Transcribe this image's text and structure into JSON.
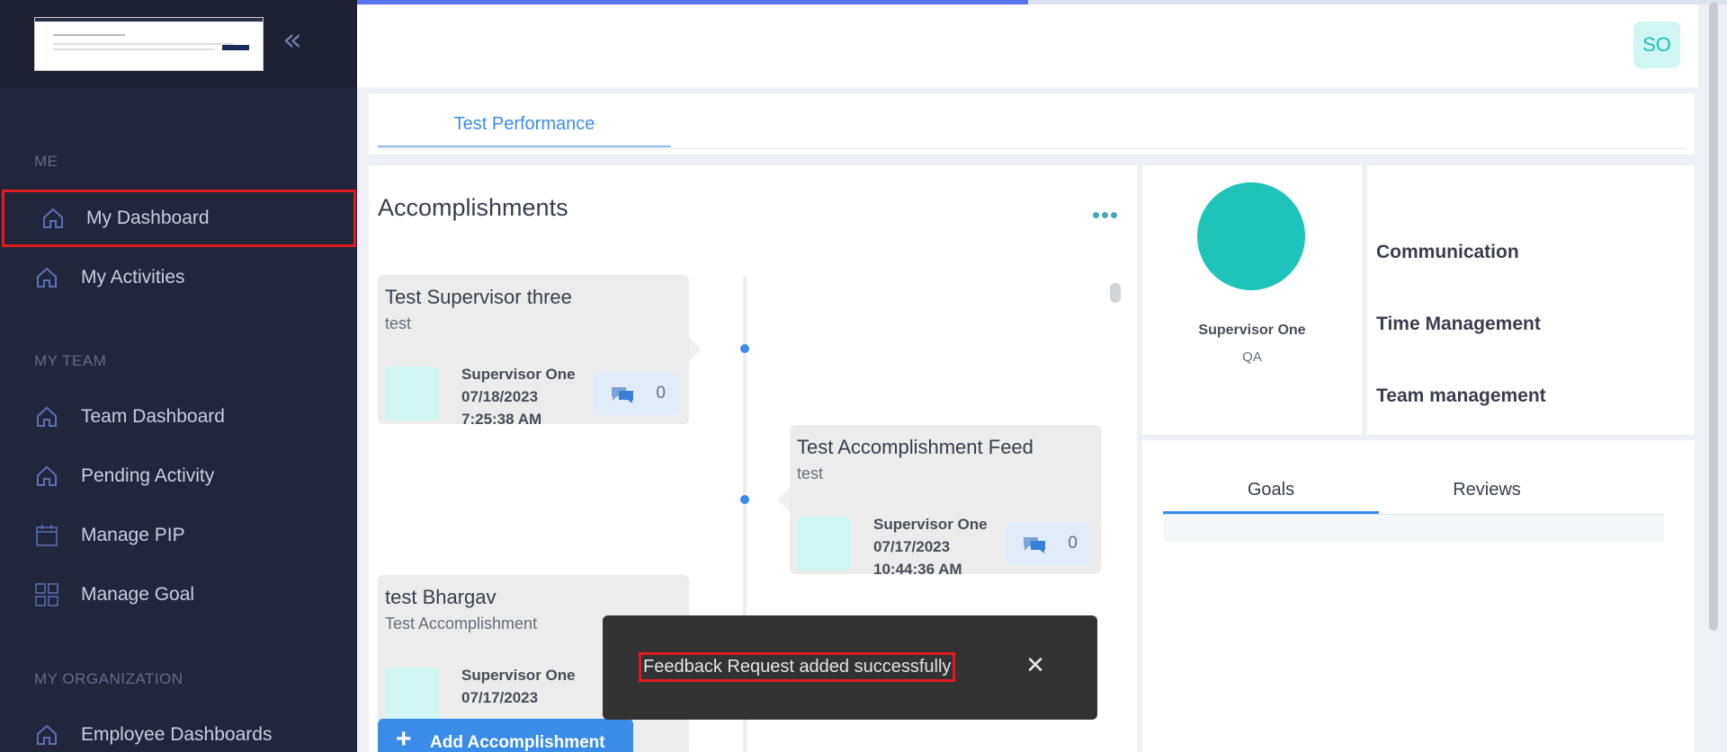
{
  "sidebar": {
    "collapse_glyph": "«",
    "sections": {
      "me": "ME",
      "my_team": "MY TEAM",
      "my_org": "MY ORGANIZATION"
    },
    "items": {
      "my_dashboard": "My Dashboard",
      "my_activities": "My Activities",
      "team_dashboard": "Team Dashboard",
      "pending_activity": "Pending Activity",
      "manage_pip": "Manage PIP",
      "manage_goal": "Manage Goal",
      "employee_dashboards": "Employee Dashboards"
    },
    "icons": [
      "home-icon",
      "calendar-icon",
      "grid-icon"
    ]
  },
  "header": {
    "avatar_initials": "SO",
    "load_progress": 0.49
  },
  "tabs": {
    "performance": "Test Performance"
  },
  "accomplishments": {
    "title": "Accomplishments",
    "cards": [
      {
        "title": "Test Supervisor three",
        "subtitle": "test",
        "author": "Supervisor One",
        "date": "07/18/2023",
        "time": "7:25:38 AM",
        "comments": "0"
      },
      {
        "title": "Test Accomplishment Feed",
        "subtitle": "test",
        "author": "Supervisor One",
        "date": "07/17/2023",
        "time": "10:44:36 AM",
        "comments": "0"
      },
      {
        "title": "test Bhargav",
        "subtitle": "Test Accomplishment",
        "author": "Supervisor One",
        "date": "07/17/2023"
      }
    ],
    "add_button": "Add Accomplishment"
  },
  "profile": {
    "name": "Supervisor One",
    "role": "QA"
  },
  "skills": [
    "Communication",
    "Time Management",
    "Team management"
  ],
  "goals_reviews": {
    "tab_goals": "Goals",
    "tab_reviews": "Reviews"
  },
  "toast": {
    "message": "Feedback Request added successfully",
    "close_glyph": "✕"
  },
  "colors": {
    "sidebar_bg": "#22263a",
    "accent_blue": "#3b8be8",
    "teal": "#1ec4b9",
    "highlight_red": "#e11b22"
  }
}
